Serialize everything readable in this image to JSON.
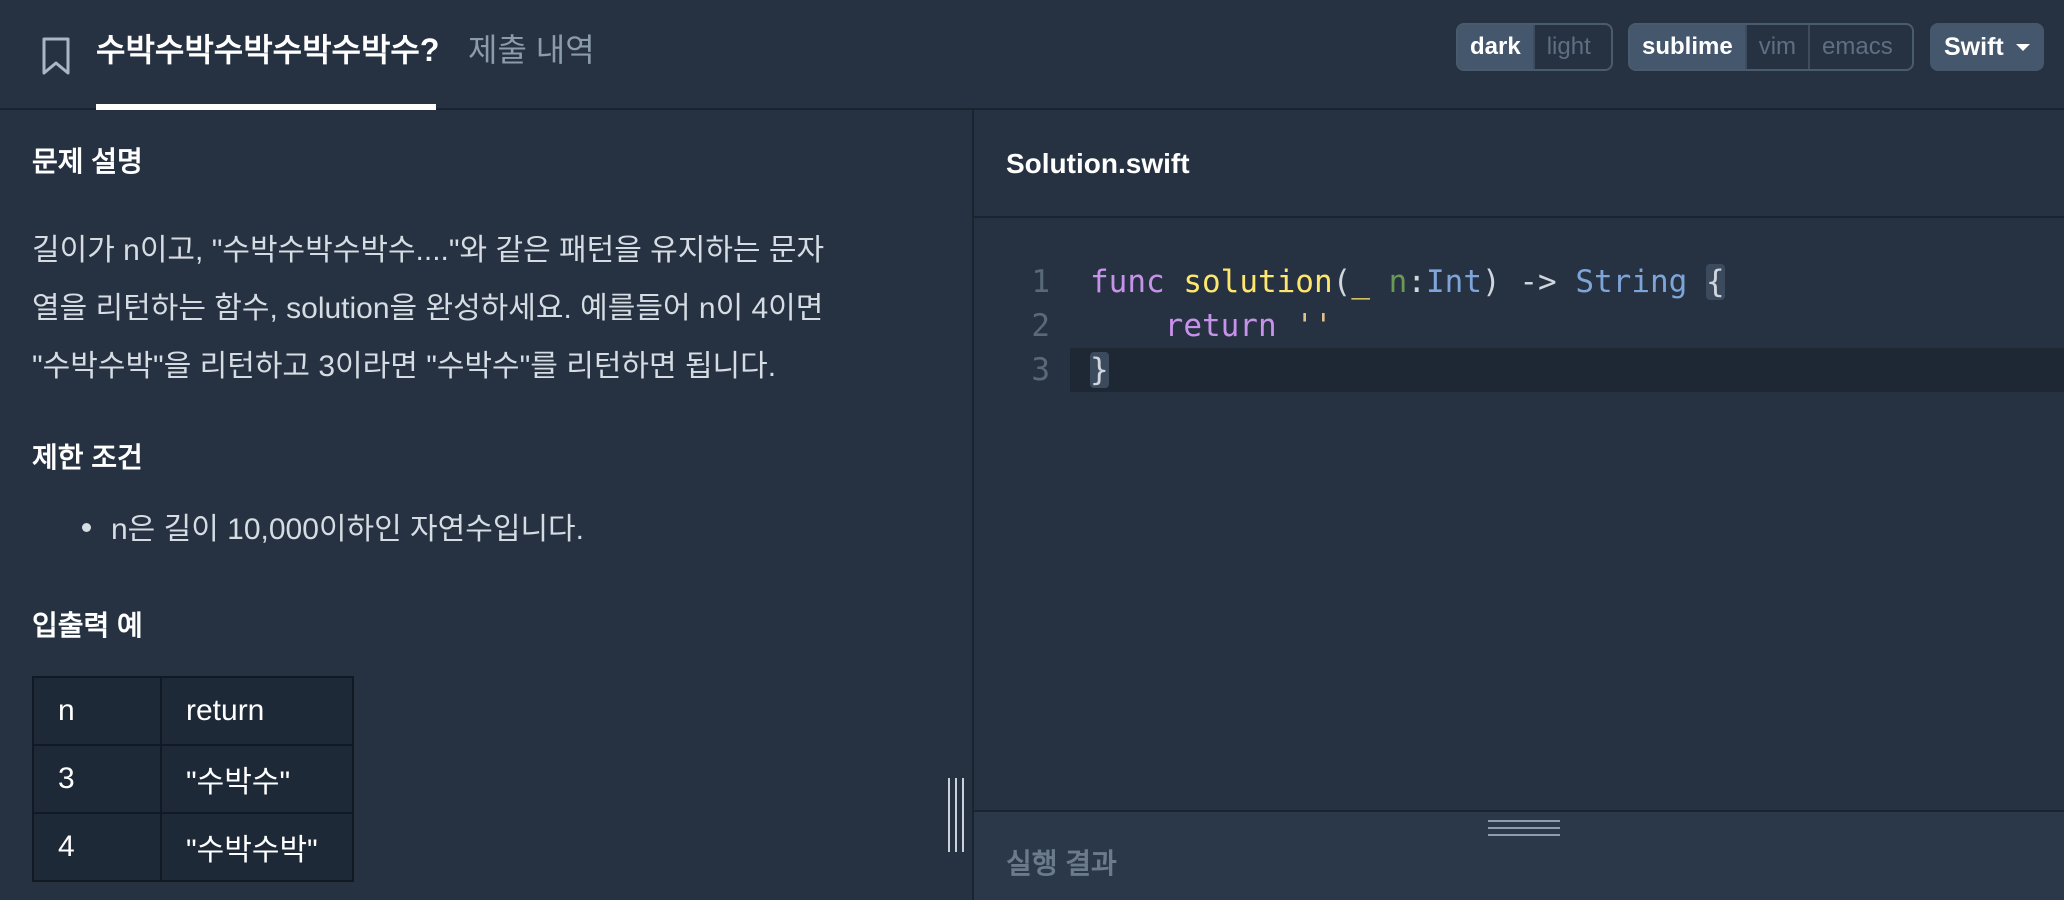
{
  "header": {
    "problem_title": "수박수박수박수박수박수?",
    "submissions_tab": "제출 내역",
    "theme_options": [
      "dark",
      "light"
    ],
    "theme_selected": "dark",
    "keymap_options": [
      "sublime",
      "vim",
      "emacs"
    ],
    "keymap_selected": "sublime",
    "language": "Swift"
  },
  "problem": {
    "description_heading": "문제 설명",
    "description_lines": [
      "길이가 n이고, \"수박수박수박수....\"와 같은 패턴을 유지하는 문자",
      "열을 리턴하는 함수, solution을 완성하세요. 예를들어 n이 4이면",
      "\"수박수박\"을 리턴하고 3이라면 \"수박수\"를 리턴하면 됩니다."
    ],
    "constraints_heading": "제한 조건",
    "constraints": [
      "n은 길이 10,000이하인 자연수입니다."
    ],
    "examples_heading": "입출력 예",
    "examples_table": {
      "headers": [
        "n",
        "return"
      ],
      "rows": [
        [
          "3",
          "\"수박수\""
        ],
        [
          "4",
          "\"수박수박\""
        ]
      ]
    }
  },
  "editor": {
    "filename": "Solution.swift",
    "line_numbers": [
      "1",
      "2",
      "3"
    ],
    "tokens": {
      "l1_func": "func",
      "l1_name": "solution",
      "l1_open": "(",
      "l1_underscore": "_",
      "l1_param": "n",
      "l1_colon": ":",
      "l1_type": "Int",
      "l1_close_arrow": ") ->",
      "l1_ret_type": "String",
      "l1_brace": "{",
      "l2_return": "return",
      "l2_str": "''",
      "l3_brace": "}"
    }
  },
  "result": {
    "heading": "실행 결과"
  }
}
